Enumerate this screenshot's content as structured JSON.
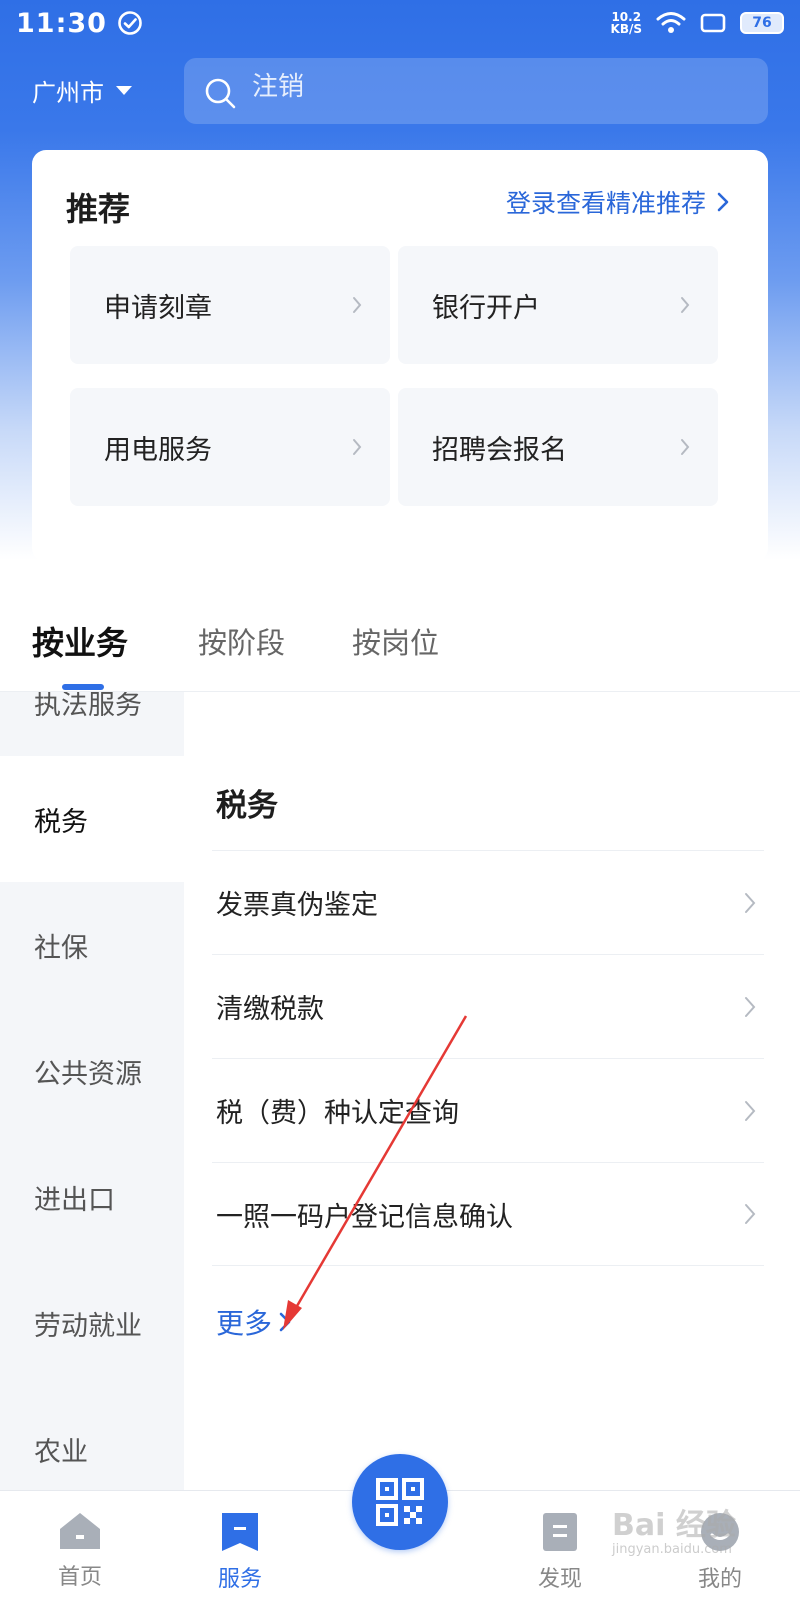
{
  "status_bar": {
    "time": "11:30",
    "net_speed_value": "10.2",
    "net_speed_unit": "KB/S",
    "battery": "76"
  },
  "header": {
    "city": "广州市",
    "search_placeholder": "注销"
  },
  "recommend": {
    "title": "推荐",
    "login_link": "登录查看精准推荐",
    "items": [
      {
        "label": "申请刻章"
      },
      {
        "label": "银行开户"
      },
      {
        "label": "用电服务"
      },
      {
        "label": "招聘会报名"
      }
    ]
  },
  "tabs": [
    {
      "label": "按业务",
      "active": true
    },
    {
      "label": "按阶段",
      "active": false
    },
    {
      "label": "按岗位",
      "active": false
    }
  ],
  "sidebar": {
    "items": [
      {
        "label": "执法服务",
        "active": false
      },
      {
        "label": "税务",
        "active": true
      },
      {
        "label": "社保",
        "active": false
      },
      {
        "label": "公共资源",
        "active": false
      },
      {
        "label": "进出口",
        "active": false
      },
      {
        "label": "劳动就业",
        "active": false
      },
      {
        "label": "农业",
        "active": false
      }
    ]
  },
  "content": {
    "category_title": "税务",
    "rows": [
      {
        "label": "发票真伪鉴定"
      },
      {
        "label": "清缴税款"
      },
      {
        "label": "税（费）种认定查询"
      },
      {
        "label": "一照一码户登记信息确认"
      }
    ],
    "more_label": "更多"
  },
  "bottom_nav": {
    "items": [
      {
        "label": "首页",
        "icon": "home-icon",
        "active": false
      },
      {
        "label": "服务",
        "icon": "bookmark-icon",
        "active": true
      },
      {
        "label": "发现",
        "icon": "document-icon",
        "active": false
      },
      {
        "label": "我的",
        "icon": "user-icon",
        "active": false
      }
    ],
    "center_icon": "qr-code-icon"
  },
  "watermark": {
    "brand": "Bai 经验",
    "url": "jingyan.baidu.com"
  },
  "colors": {
    "primary": "#2f6fe6",
    "link": "#2a67d9",
    "annotation_arrow": "#e53935"
  }
}
